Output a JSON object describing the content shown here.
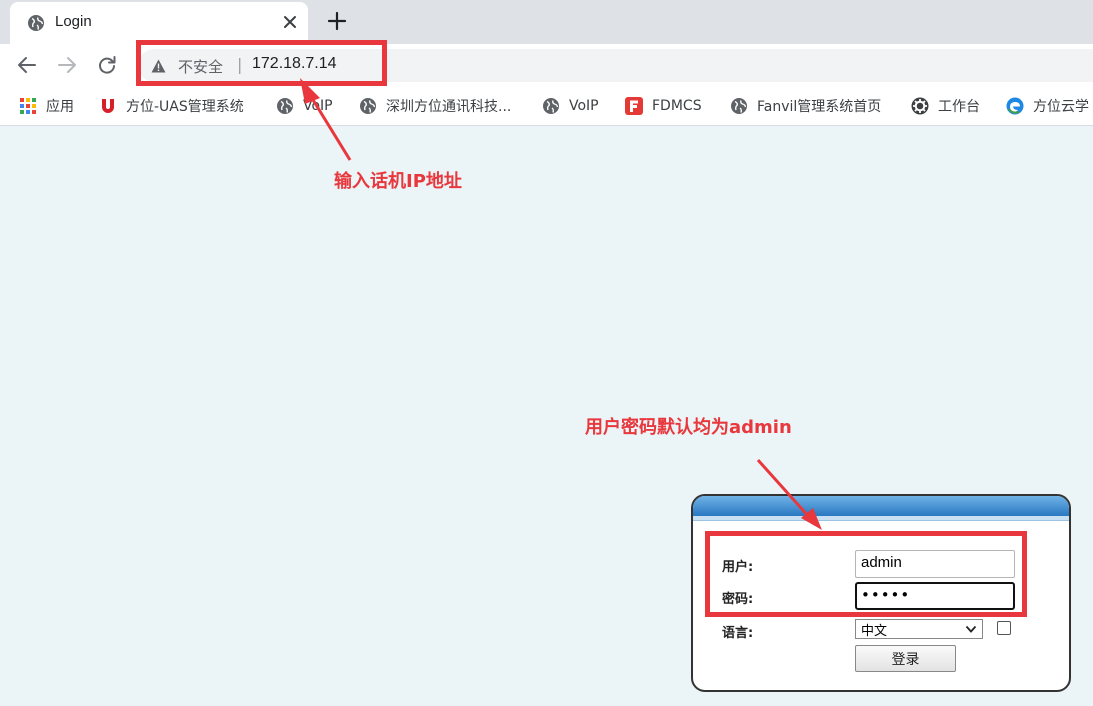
{
  "browser": {
    "tab": {
      "title": "Login",
      "icon": "globe-icon"
    },
    "toolbar": {
      "back_icon": "arrow-left-icon",
      "forward_icon": "arrow-right-icon",
      "reload_icon": "reload-icon",
      "security_text": "不安全",
      "separator": "|",
      "url": "172.18.7.14"
    },
    "bookmarks": [
      {
        "label": "应用",
        "icon": "apps-grid-icon"
      },
      {
        "label": "方位-UAS管理系统",
        "icon": "u-logo-icon"
      },
      {
        "label": "VoIP",
        "icon": "globe-icon"
      },
      {
        "label": "深圳方位通讯科技...",
        "icon": "globe-icon"
      },
      {
        "label": "VoIP",
        "icon": "globe-icon"
      },
      {
        "label": "FDMCS",
        "icon": "f-logo-icon"
      },
      {
        "label": "Fanvil管理系统首页",
        "icon": "globe-icon"
      },
      {
        "label": "工作台",
        "icon": "gear-icon"
      },
      {
        "label": "方位云学",
        "icon": "edge-logo-icon"
      }
    ]
  },
  "login": {
    "username_label": "用户:",
    "username_value": "admin",
    "password_label": "密码:",
    "password_value": "•••••",
    "language_label": "语言:",
    "language_value": "中文",
    "submit_label": "登录"
  },
  "annotations": {
    "url_note": "输入话机IP地址",
    "credential_note": "用户密码默认均为admin",
    "color": "#e8383d"
  },
  "colors": {
    "page_background": "#ebf4f6",
    "tabstrip": "#dee1e6",
    "login_header": "#2a78c2"
  }
}
